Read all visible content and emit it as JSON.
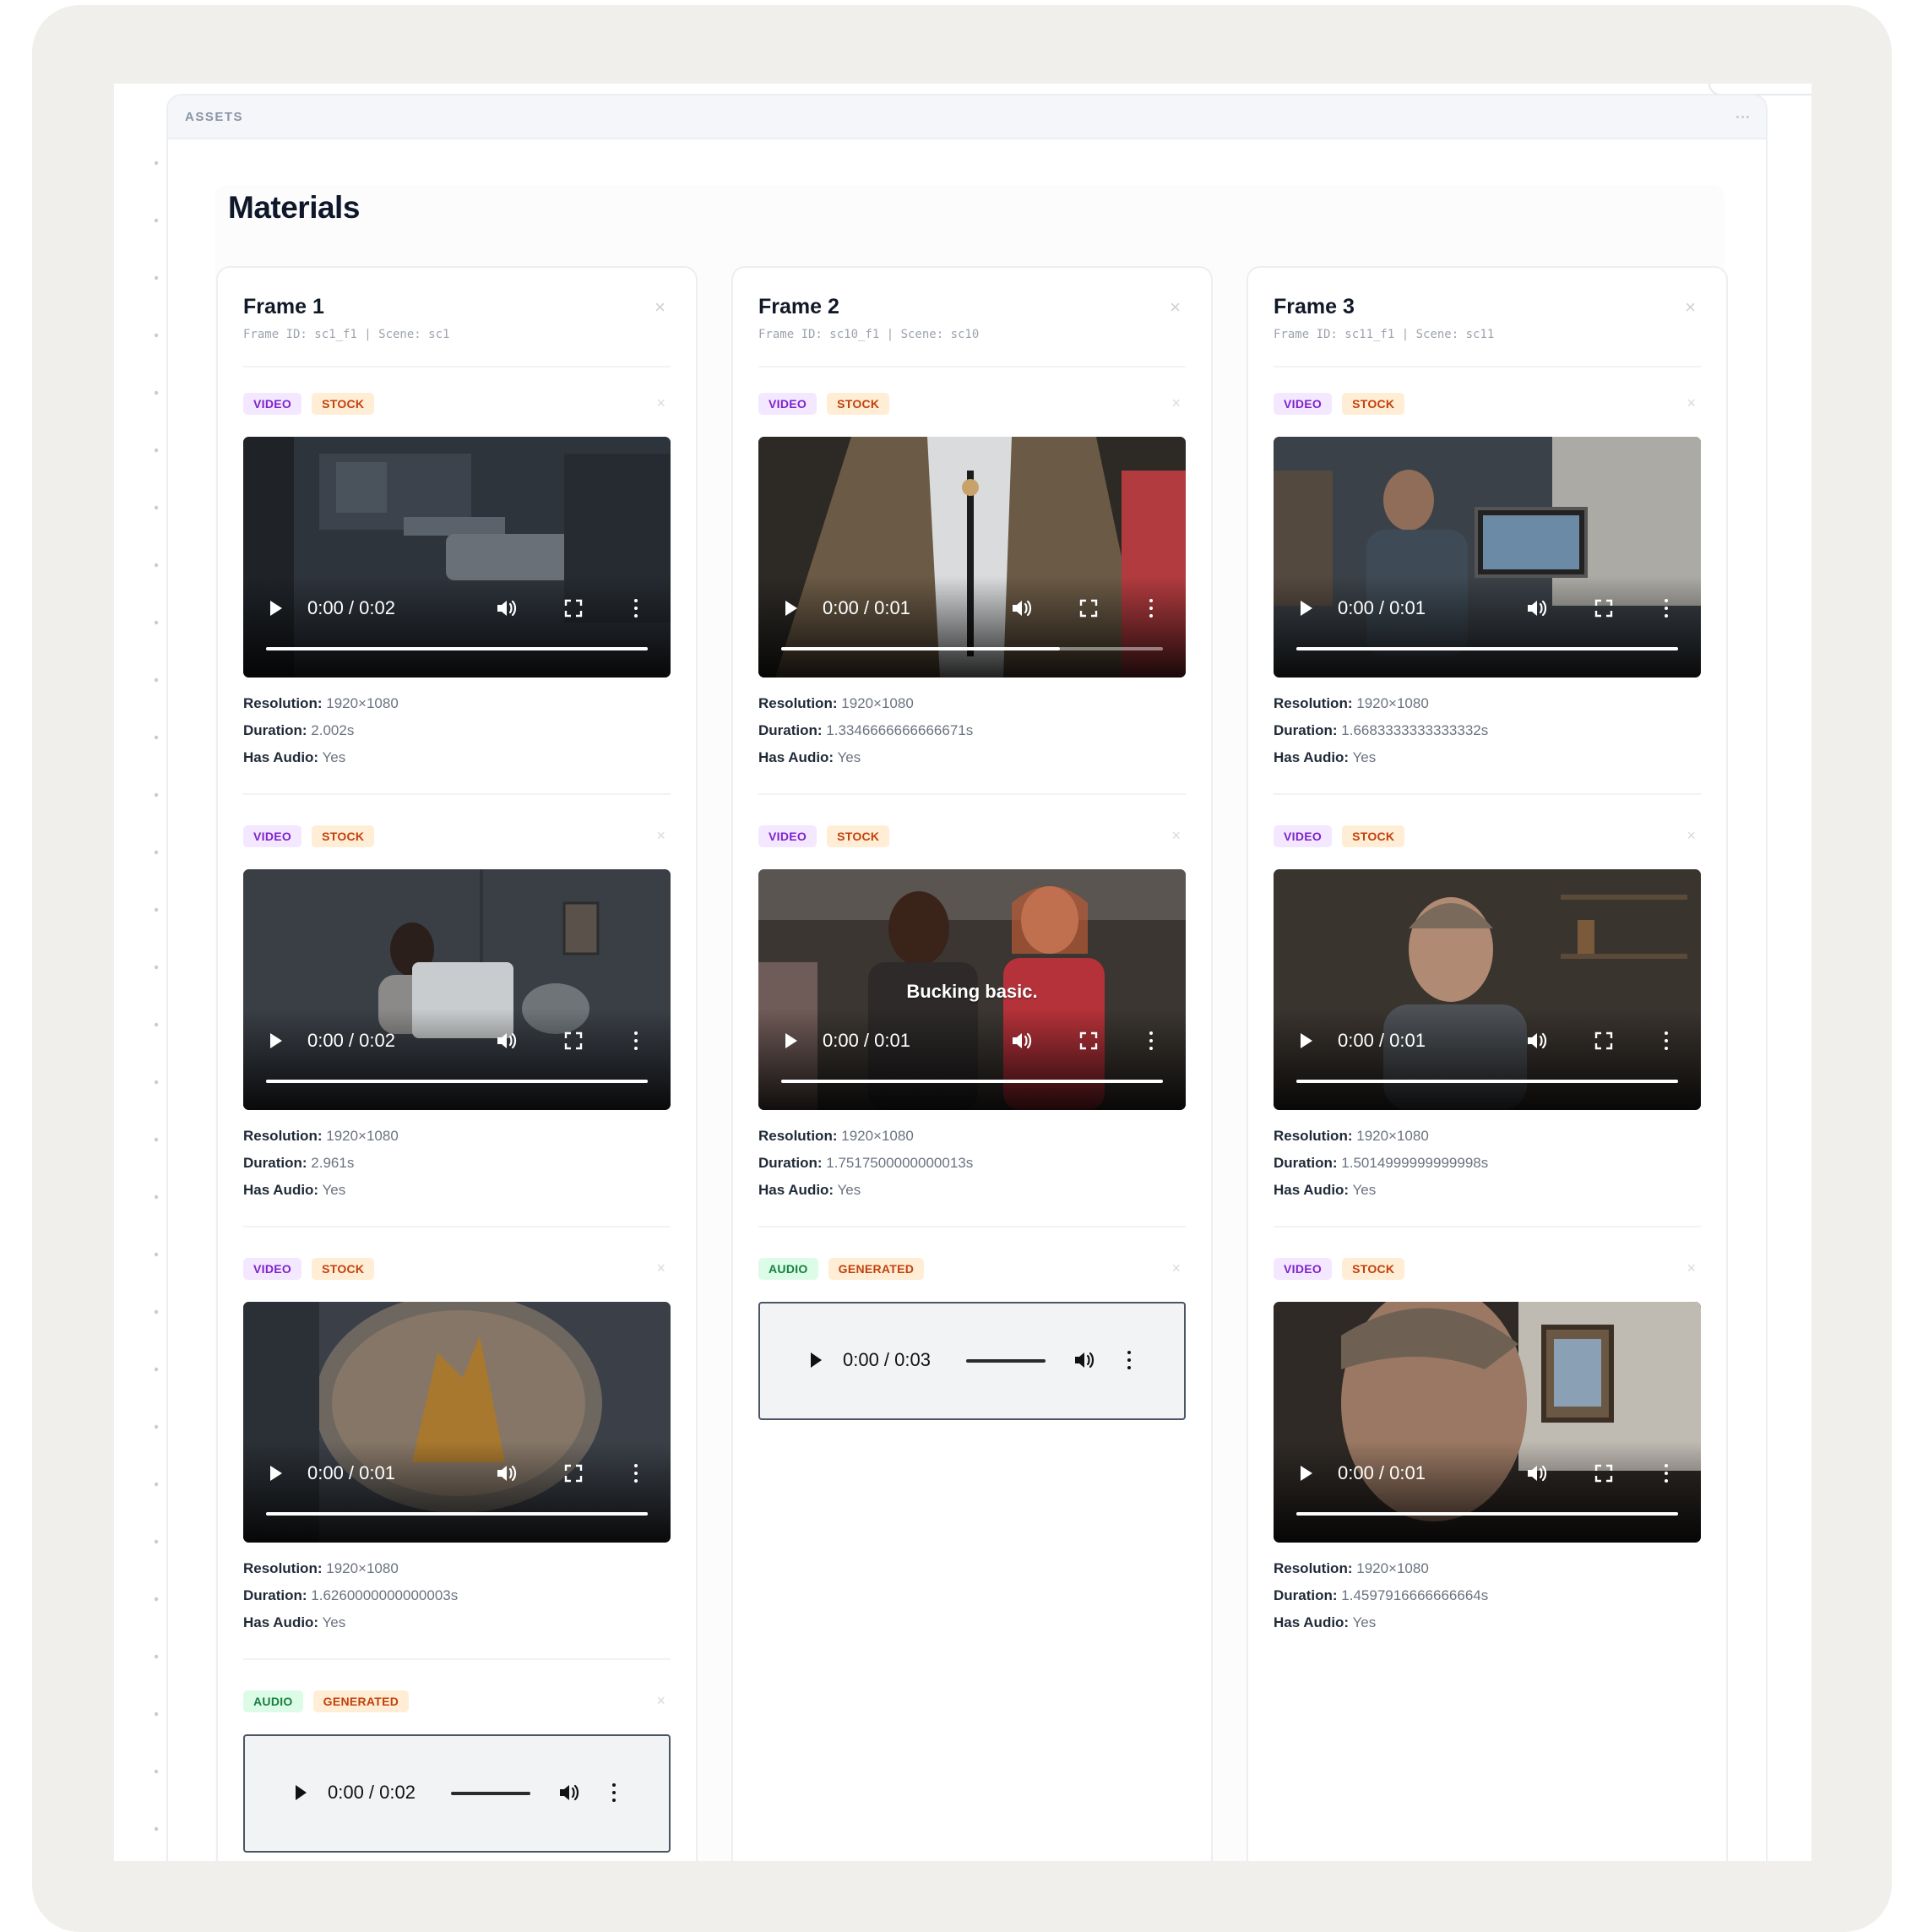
{
  "panel": {
    "title": "ASSETS"
  },
  "section": {
    "title": "Materials"
  },
  "frames": [
    {
      "title": "Frame 1",
      "meta": "Frame ID: sc1_f1 | Scene: sc1",
      "materials": [
        {
          "type": "video",
          "badges": [
            "VIDEO",
            "STOCK"
          ],
          "time": "0:00 / 0:02",
          "progress": 1.0,
          "resolution": "1920×1080",
          "duration": "2.002s",
          "has_audio": "Yes",
          "scene": "dark-living-room"
        },
        {
          "type": "video",
          "badges": [
            "VIDEO",
            "STOCK"
          ],
          "time": "0:00 / 0:02",
          "progress": 1.0,
          "resolution": "1920×1080",
          "duration": "2.961s",
          "has_audio": "Yes",
          "scene": "woman-laptop-night"
        },
        {
          "type": "video",
          "badges": [
            "VIDEO",
            "STOCK"
          ],
          "time": "0:00 / 0:01",
          "progress": 1.0,
          "resolution": "1920×1080",
          "duration": "1.6260000000000003s",
          "has_audio": "Yes",
          "scene": "fishbowl-castle"
        },
        {
          "type": "audio",
          "badges": [
            "AUDIO",
            "GENERATED"
          ],
          "time": "0:00 / 0:02"
        }
      ]
    },
    {
      "title": "Frame 2",
      "meta": "Frame ID: sc10_f1 | Scene: sc10",
      "materials": [
        {
          "type": "video",
          "badges": [
            "VIDEO",
            "STOCK"
          ],
          "time": "0:00 / 0:01",
          "progress": 0.73,
          "resolution": "1920×1080",
          "duration": "1.3346666666666671s",
          "has_audio": "Yes",
          "scene": "man-tweed-jacket-bolo"
        },
        {
          "type": "video",
          "badges": [
            "VIDEO",
            "STOCK"
          ],
          "time": "0:00 / 0:01",
          "progress": 1.0,
          "resolution": "1920×1080",
          "duration": "1.7517500000000013s",
          "has_audio": "Yes",
          "caption": "Bucking basic.",
          "scene": "office-pair-smiling"
        },
        {
          "type": "audio",
          "badges": [
            "AUDIO",
            "GENERATED"
          ],
          "time": "0:00 / 0:03"
        }
      ]
    },
    {
      "title": "Frame 3",
      "meta": "Frame ID: sc11_f1 | Scene: sc11",
      "materials": [
        {
          "type": "video",
          "badges": [
            "VIDEO",
            "STOCK"
          ],
          "time": "0:00 / 0:01",
          "progress": 1.0,
          "resolution": "1920×1080",
          "duration": "1.6683333333333332s",
          "has_audio": "Yes",
          "scene": "man-desk-monitors"
        },
        {
          "type": "video",
          "badges": [
            "VIDEO",
            "STOCK"
          ],
          "time": "0:00 / 0:01",
          "progress": 1.0,
          "resolution": "1920×1080",
          "duration": "1.5014999999999998s",
          "has_audio": "Yes",
          "scene": "man-portrait-shelves"
        },
        {
          "type": "video",
          "badges": [
            "VIDEO",
            "STOCK"
          ],
          "time": "0:00 / 0:01",
          "progress": 1.0,
          "resolution": "1920×1080",
          "duration": "1.4597916666666664s",
          "has_audio": "Yes",
          "scene": "man-profile-photo-frame"
        }
      ]
    }
  ],
  "labels": {
    "resolution": "Resolution:",
    "duration": "Duration:",
    "has_audio": "Has Audio:"
  },
  "colors": {
    "video_badge": "#7e22ce",
    "stock_badge": "#c2410c",
    "audio_badge": "#15803d",
    "generated_badge": "#c2410c"
  }
}
